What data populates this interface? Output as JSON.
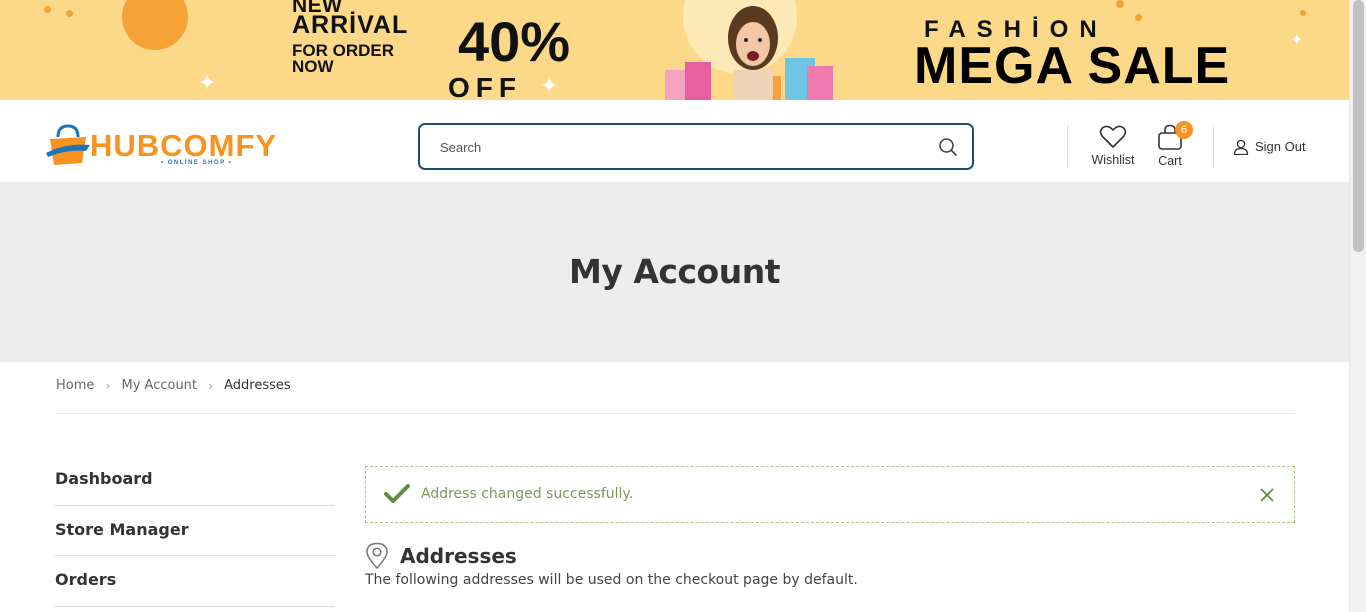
{
  "promo_banner": {
    "line1": "NEW",
    "line2": "ARRİVAL",
    "line3": "FOR ORDER NOW",
    "discount": "40%",
    "discount_suffix": "OFF",
    "headline_small": "FASHİON",
    "headline_big": "MEGA SALE"
  },
  "header": {
    "logo_text": "HUBCOMFY",
    "logo_subtext": "• ONLİNE SHOP •",
    "search_placeholder": "Search",
    "wishlist_label": "Wishlist",
    "cart_label": "Cart",
    "cart_count": "6",
    "signout_label": "Sign Out"
  },
  "page": {
    "title": "My Account"
  },
  "breadcrumb": [
    "Home",
    "My Account",
    "Addresses"
  ],
  "sidenav": {
    "items": [
      "Dashboard",
      "Store Manager",
      "Orders"
    ]
  },
  "notice": {
    "message": "Address changed successfully."
  },
  "addresses": {
    "heading": "Addresses",
    "description": "The following addresses will be used on the checkout page by default."
  },
  "colors": {
    "brand_orange": "#f7931e",
    "brand_blue": "#1b75bb",
    "banner_bg": "#fbd988",
    "success_green": "#5f8d3e"
  }
}
